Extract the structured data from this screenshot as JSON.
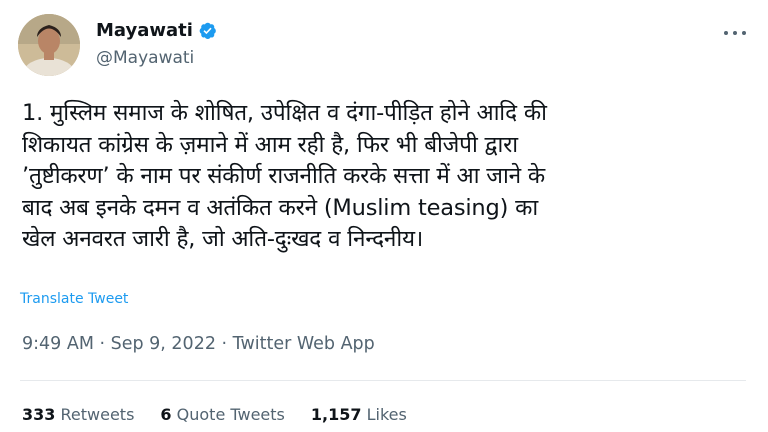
{
  "user": {
    "display_name": "Mayawati",
    "handle": "@Mayawati",
    "verified": true
  },
  "tweet": {
    "lines": [
      "1. मुस्लिम समाज के शोषित, उपेक्षित व दंगा-पीड़ित होने आदि की",
      "शिकायत कांग्रेस के ज़माने में आम रही है, फिर भी बीजेपी द्वारा",
      "’तुष्टीकरण’ के नाम पर संकीर्ण राजनीति करके सत्ता में आ जाने के",
      "बाद अब इनके दमन व अतंकित करने (Muslim teasing) का",
      "खेल अनवरत जारी है, जो अति-दुःखद व निन्दनीय।"
    ],
    "translate_label": "Translate Tweet",
    "meta": "9:49 AM · Sep 9, 2022 · Twitter Web App"
  },
  "stats": {
    "retweets_count": "333",
    "retweets_label": "Retweets",
    "quotes_count": "6",
    "quotes_label": "Quote Tweets",
    "likes_count": "1,157",
    "likes_label": "Likes"
  },
  "colors": {
    "accent": "#1d9bf0",
    "secondary_text": "#536471",
    "primary_text": "#0f1419"
  },
  "icons": {
    "verified": "verified-badge-icon",
    "more": "more-options-icon"
  }
}
